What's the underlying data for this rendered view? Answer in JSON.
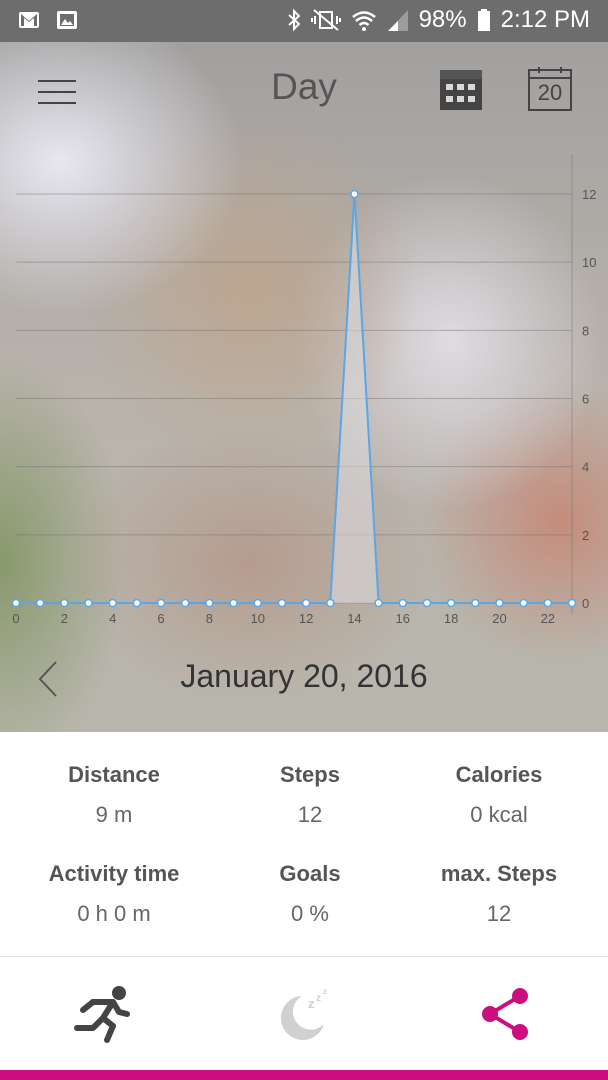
{
  "status_bar": {
    "battery": "98%",
    "time": "2:12 PM",
    "icons": [
      "gmail-icon",
      "image-icon",
      "bluetooth-icon",
      "vibrate-mute-icon",
      "wifi-icon",
      "signal-icon",
      "battery-icon"
    ]
  },
  "header": {
    "title": "Day",
    "menu_icon": "hamburger-menu-icon",
    "grid_icon": "calendar-grid-icon",
    "calendar_day": "20"
  },
  "chart_data": {
    "type": "area",
    "x": [
      0,
      1,
      2,
      3,
      4,
      5,
      6,
      7,
      8,
      9,
      10,
      11,
      12,
      13,
      14,
      15,
      16,
      17,
      18,
      19,
      20,
      21,
      22,
      23
    ],
    "series": [
      {
        "values": [
          0,
          0,
          0,
          0,
          0,
          0,
          0,
          0,
          0,
          0,
          0,
          0,
          0,
          0,
          12,
          0,
          0,
          0,
          0,
          0,
          0,
          0,
          0,
          0
        ]
      }
    ],
    "x_ticks": [
      "0",
      "2",
      "4",
      "6",
      "8",
      "10",
      "12",
      "14",
      "16",
      "18",
      "20",
      "22"
    ],
    "y_ticks": [
      "0",
      "2",
      "4",
      "6",
      "8",
      "10",
      "12"
    ],
    "ylim": [
      0,
      12
    ],
    "grid": true,
    "y_axis_side": "right",
    "line_color": "#5aa6e6"
  },
  "date_nav": {
    "prev_icon": "chevron-left-icon",
    "date": "January 20, 2016"
  },
  "stats": [
    {
      "label": "Distance",
      "value": "9 m"
    },
    {
      "label": "Steps",
      "value": "12"
    },
    {
      "label": "Calories",
      "value": "0 kcal"
    },
    {
      "label": "Activity time",
      "value": "0 h 0 m"
    },
    {
      "label": "Goals",
      "value": "0 %"
    },
    {
      "label": "max. Steps",
      "value": "12"
    }
  ],
  "bottom_nav": [
    {
      "icon": "running-icon",
      "color": "#444444"
    },
    {
      "icon": "sleep-moon-icon",
      "color": "#d0d0d0"
    },
    {
      "icon": "share-icon",
      "color": "#cc0d7e"
    }
  ],
  "accent_color": "#cc0d7e"
}
